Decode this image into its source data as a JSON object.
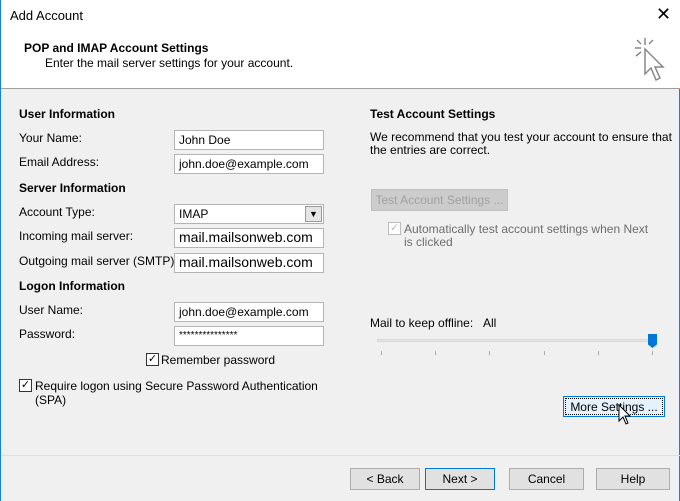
{
  "window": {
    "title": "Add Account",
    "close_icon": "close-icon"
  },
  "header": {
    "title": "POP and IMAP Account Settings",
    "subtitle": "Enter the mail server settings for your account."
  },
  "user_info": {
    "heading": "User Information",
    "name_label": "Your Name:",
    "name_value": "John Doe",
    "email_label": "Email Address:",
    "email_value": "john.doe@example.com"
  },
  "server_info": {
    "heading": "Server Information",
    "type_label": "Account Type:",
    "type_value": "IMAP",
    "incoming_label": "Incoming mail server:",
    "incoming_value": "mail.mailsonweb.com",
    "outgoing_label": "Outgoing mail server (SMTP):",
    "outgoing_value": "mail.mailsonweb.com"
  },
  "logon_info": {
    "heading": "Logon Information",
    "user_label": "User Name:",
    "user_value": "john.doe@example.com",
    "password_label": "Password:",
    "password_value": "***************",
    "remember_label": "Remember password",
    "remember_checked": true,
    "spa_label_1": "Require logon using Secure Password Authentication",
    "spa_label_2": "(SPA)",
    "spa_checked": true
  },
  "test": {
    "heading": "Test Account Settings",
    "desc_1": "We recommend that you test your account to ensure that",
    "desc_2": "the entries are correct.",
    "button": "Test Account Settings ...",
    "auto_label_1": "Automatically test account settings when Next",
    "auto_label_2": "is clicked",
    "auto_checked": true
  },
  "offline": {
    "label": "Mail to keep offline:",
    "value": "All",
    "slider_position": 1.0
  },
  "more_settings": "More Settings ...",
  "footer": {
    "back": "< Back",
    "next": "Next >",
    "cancel": "Cancel",
    "help": "Help"
  }
}
